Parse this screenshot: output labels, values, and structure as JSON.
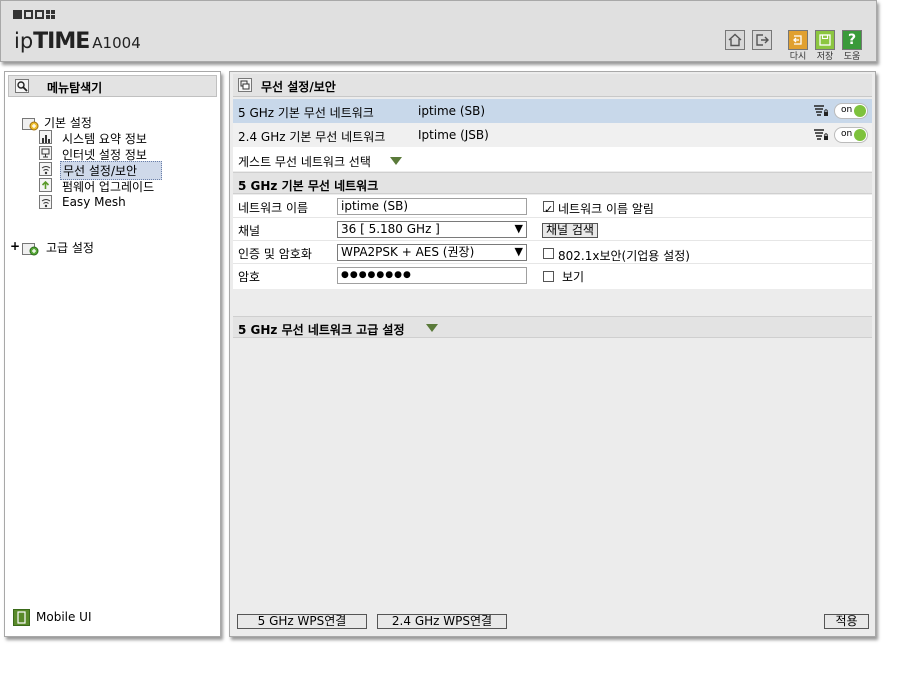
{
  "header": {
    "logo_ip": "ip",
    "logo_time": "TIME",
    "model": "A1004",
    "buttons": [
      {
        "label": "다시"
      },
      {
        "label": "저장"
      },
      {
        "label": "도움"
      }
    ],
    "colors": {
      "accent_yellow": "#e0a030",
      "accent_green": "#5aaa3a",
      "help_green": "#3a9a3a"
    }
  },
  "sidebar": {
    "title": "메뉴탐색기",
    "groups": [
      {
        "label": "기본 설정",
        "items": [
          "시스템 요약 정보",
          "인터넷 설정 정보",
          "무선 설정/보안",
          "펌웨어 업그레이드",
          "Easy Mesh"
        ],
        "selected": 2
      },
      {
        "label": "고급 설정",
        "collapsed_marker": "+"
      }
    ],
    "mobile_ui": "Mobile UI"
  },
  "main": {
    "title": "무선 설정/보안",
    "networks": [
      {
        "band": "5 GHz 기본 무선 네트워크",
        "ssid": "iptime (SB)",
        "toggle": "on"
      },
      {
        "band": "2.4 GHz 기본 무선 네트워크",
        "ssid": "Iptime (JSB)",
        "toggle": "on"
      }
    ],
    "guest_select": "게스트 무선 네트워크 선택",
    "section_basic": "5 GHz 기본 무선 네트워크",
    "form": {
      "network_name_label": "네트워크 이름",
      "network_name_value": "iptime (SB)",
      "broadcast_label": "네트워크 이름 알림",
      "channel_label": "채널",
      "channel_value": "36 [ 5.180 GHz ]",
      "channel_search": "채널 검색",
      "auth_label": "인증 및 암호화",
      "auth_value": "WPA2PSK + AES (권장)",
      "enterprise_label": "802.1x보안(기업용 설정)",
      "password_label": "암호",
      "password_value": "●●●●●●●●",
      "show_label": "보기"
    },
    "section_advanced": "5 GHz 무선 네트워크 고급 설정",
    "footer": {
      "wps5": "5 GHz WPS연결",
      "wps24": "2.4 GHz WPS연결",
      "apply": "적용"
    },
    "row_highlight": "#c8d8ea",
    "toggle_color": "#7ec23c"
  }
}
